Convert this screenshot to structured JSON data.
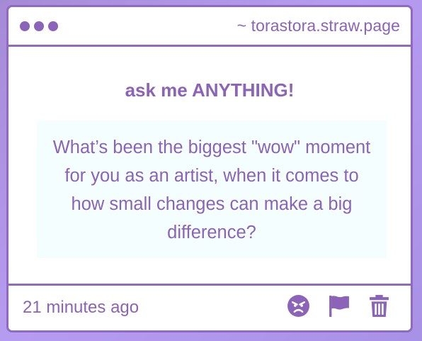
{
  "window": {
    "url": "~ torastora.straw.page"
  },
  "main": {
    "heading": "ask me ANYTHING!",
    "question": "What’s been the biggest \"wow\" moment for you as an artist, when it comes to how small changes can make a big difference?"
  },
  "footer": {
    "timestamp": "21 minutes ago",
    "actions": [
      {
        "icon": "angry-face-icon"
      },
      {
        "icon": "flag-icon"
      },
      {
        "icon": "trash-icon"
      }
    ]
  },
  "colors": {
    "accent": "#8b63b9",
    "border": "#8f6ac0",
    "question_bg": "#f4feff",
    "background": "#b69cf0"
  }
}
